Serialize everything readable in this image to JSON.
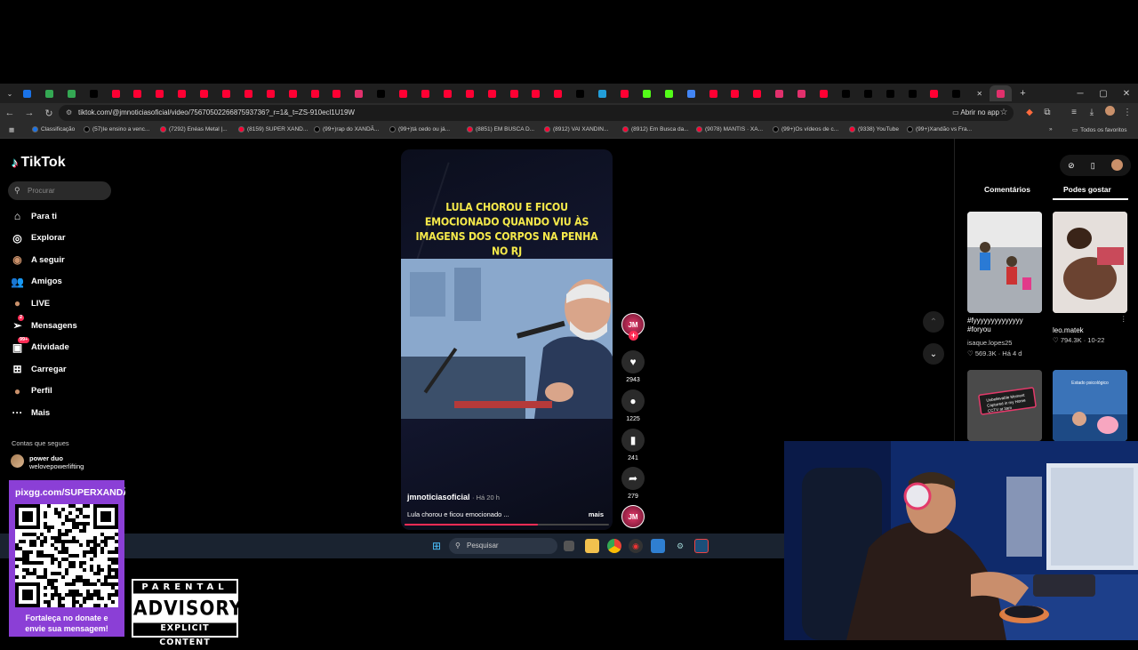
{
  "browser": {
    "tab_count": 45,
    "active_tab_index": 44,
    "tab_colors": [
      "#1a73e8",
      "#34a853",
      "#34a853",
      "#000000",
      "#ff0033",
      "#ff0033",
      "#ff0033",
      "#ff0033",
      "#ff0033",
      "#ff0033",
      "#ff0033",
      "#ff0033",
      "#ff0033",
      "#ff0033",
      "#ff0033",
      "#e1306c",
      "#000000",
      "#ff0033",
      "#ff0033",
      "#ff0033",
      "#ff0033",
      "#ff0033",
      "#ff0033",
      "#ff0033",
      "#ff0033",
      "#000000",
      "#229ed9",
      "#ff0033",
      "#53fc18",
      "#53fc18",
      "#4285f4",
      "#ff0033",
      "#ff0033",
      "#ff0033",
      "#e1306c",
      "#e1306c",
      "#ff0033",
      "#000000",
      "#000000",
      "#000000",
      "#000000",
      "#ff0033",
      "#000000",
      "#000000",
      "#e1306c"
    ],
    "url": "tiktok.com/@jmnoticiasoficial/video/7567050226687593736?_r=1&_t=ZS-910ecl1U19W",
    "open_app_label": "Abrir no app",
    "bookmarks": [
      {
        "label": "Classificação",
        "color": "#1a73e8"
      },
      {
        "label": "(57)Ie ensino a venc...",
        "color": "#000000"
      },
      {
        "label": "(7292) Enéas Metal |...",
        "color": "#ff0033"
      },
      {
        "label": "(8159) SUPER XAND...",
        "color": "#ff0033"
      },
      {
        "label": "(99+)rap do XANDÃ...",
        "color": "#000000"
      },
      {
        "label": "(99+)tá cedo ou já...",
        "color": "#000000"
      },
      {
        "label": "(8851) EM BUSCA D...",
        "color": "#ff0033"
      },
      {
        "label": "(8912) VAI XANDIN...",
        "color": "#ff0033"
      },
      {
        "label": "(8912) Em Busca da...",
        "color": "#ff0033"
      },
      {
        "label": "(9078) MANTIS · XA...",
        "color": "#ff0033"
      },
      {
        "label": "(99+)Os vídeos de c...",
        "color": "#000000"
      },
      {
        "label": "(9338) YouTube",
        "color": "#ff0033"
      },
      {
        "label": "(99+)Xandão vs Fra...",
        "color": "#000000"
      }
    ],
    "all_bookmarks_label": "Todos os favoritos"
  },
  "tiktok": {
    "logo": "TikTok",
    "search_placeholder": "Procurar",
    "nav": [
      {
        "label": "Para ti",
        "icon": "home-icon"
      },
      {
        "label": "Explorar",
        "icon": "compass-icon"
      },
      {
        "label": "A seguir",
        "icon": "following-icon"
      },
      {
        "label": "Amigos",
        "icon": "friends-icon"
      },
      {
        "label": "LIVE",
        "icon": "live-icon"
      },
      {
        "label": "Mensagens",
        "icon": "messages-icon",
        "badge": "2"
      },
      {
        "label": "Atividade",
        "icon": "activity-icon",
        "badge": "99+"
      },
      {
        "label": "Carregar",
        "icon": "upload-icon"
      },
      {
        "label": "Perfil",
        "icon": "profile-icon"
      },
      {
        "label": "Mais",
        "icon": "more-icon"
      }
    ],
    "following_title": "Contas que segues",
    "following": [
      {
        "name": "power duo",
        "handle": "welovepowerlifting"
      }
    ],
    "video": {
      "headline": "LULA CHOROU E FICOU EMOCIONADO QUANDO VIU ÀS IMAGENS DOS CORPOS NA PENHA NO RJ",
      "author": "jmnoticiasoficial",
      "time": "· Há 20 h",
      "description": "Lula chorou e ficou emocionado ...",
      "more": "mais",
      "progress": 0.65,
      "avatar_text": "JM"
    },
    "actions": {
      "likes": "2943",
      "comments": "1225",
      "saves": "241",
      "shares": "279"
    },
    "right_panel": {
      "tabs": [
        "Comentários",
        "Podes gostar"
      ],
      "active_tab": "Podes gostar",
      "suggestions": [
        {
          "title": "#fyyyyyyyyyyyyyy #foryou",
          "author": "isaque.lopes25",
          "likes": "569.3K",
          "date": "Há 4 d"
        },
        {
          "title": "",
          "author": "leo.matek",
          "likes": "794.3K",
          "date": "10-22"
        },
        {
          "title": "Unbelievable Moment Captured in my Home CCTV at 3am",
          "author": "",
          "likes": "",
          "date": ""
        },
        {
          "title": "Estado psicológico",
          "author": "",
          "likes": "",
          "date": ""
        }
      ]
    }
  },
  "taskbar": {
    "search_placeholder": "Pesquisar"
  },
  "overlay": {
    "donate_url": "pixgg.com/SUPERXANDÃO",
    "donate_caption_1": "Fortaleça no donate e",
    "donate_caption_2": "envie sua mensagem!",
    "advisory_top": "PARENTAL",
    "advisory_mid": "ADVISORY",
    "advisory_bot": "EXPLICIT CONTENT"
  }
}
